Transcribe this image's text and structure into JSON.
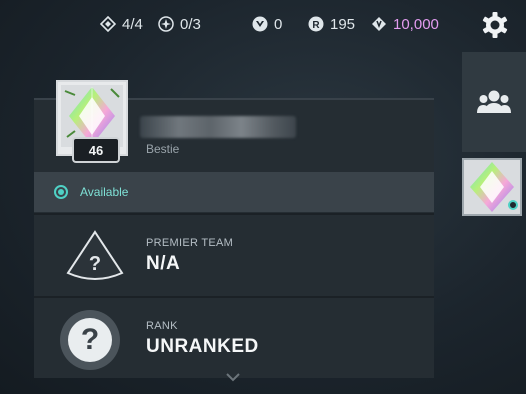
{
  "topbar": {
    "agent_contracts": "4/4",
    "free_agents": "0/3",
    "kingdom_credits": "0",
    "radianite": "195",
    "valorant_points": "10,000"
  },
  "profile": {
    "level": "46",
    "tag_line": "Bestie",
    "status": "Available"
  },
  "premier": {
    "label": "PREMIER TEAM",
    "value": "N/A"
  },
  "rank": {
    "label": "RANK",
    "value": "UNRANKED"
  },
  "colors": {
    "available": "#4fd1c5",
    "vp_pink": "#e39cf0",
    "panel": "#252d33"
  }
}
